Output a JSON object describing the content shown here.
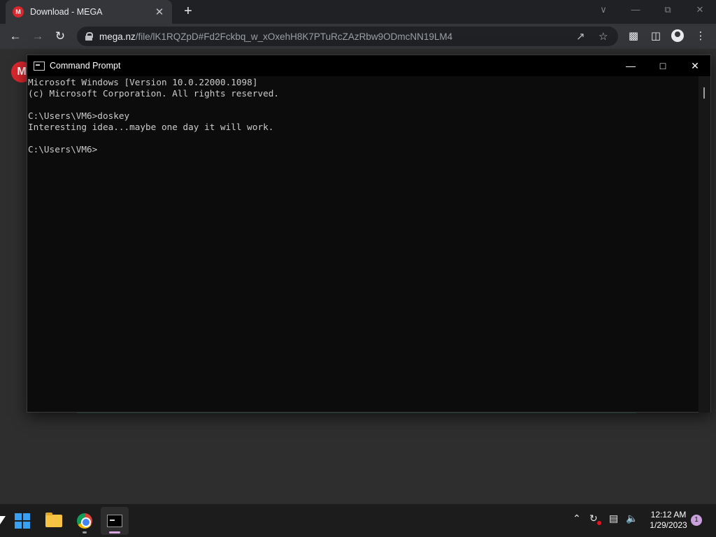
{
  "browser": {
    "tab": {
      "favicon": "M",
      "title": "Download - MEGA",
      "close": "✕"
    },
    "new_tab": "+",
    "url_host": "mega.nz",
    "url_path": "/file/lK1RQZpD#Fd2Fckbq_w_xOxehH8K7PTuRcZAzRbw9ODmcNN19LM4",
    "logo_letter": "M"
  },
  "cmd": {
    "title": "Command Prompt",
    "lines": [
      "Microsoft Windows [Version 10.0.22000.1098]",
      "(c) Microsoft Corporation. All rights reserved.",
      "",
      "C:\\Users\\VM6>doskey",
      "Interesting idea...maybe one day it will work.",
      "",
      "C:\\Users\\VM6>"
    ]
  },
  "taskbar": {
    "time": "12:12 AM",
    "date": "1/29/2023",
    "notification_count": "1"
  },
  "icons": {
    "back": "arrow-left-icon",
    "forward": "arrow-right-icon",
    "reload": "reload-icon",
    "share": "share-icon",
    "bookmark": "star-icon",
    "extensions": "puzzle-icon",
    "sidepanel": "side-panel-icon",
    "profile": "profile-icon",
    "menu": "kebab-menu-icon"
  },
  "colors": {
    "mega_red": "#d9272e",
    "terminal_bg": "#0c0c0c",
    "terminal_text": "#cccccc",
    "taskbar_bg": "#1c1c1c"
  }
}
